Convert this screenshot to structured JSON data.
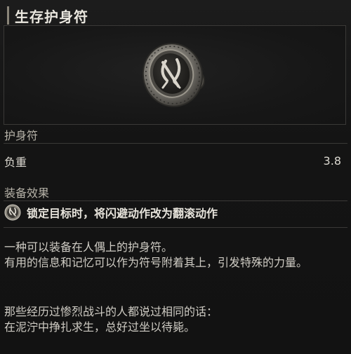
{
  "item": {
    "title": "生存护身符",
    "category": "护身符",
    "weight_label": "负重",
    "weight_value": "3.8",
    "effect_section_label": "装备效果",
    "effect_text": "锁定目标时，将闪避动作改为翻滚动作",
    "description_1": "一种可以装备在人偶上的护身符。",
    "description_2": "有用的信息和记忆可以作为符号附着其上，引发特殊的力量。",
    "description_3": "那些经历过惨烈战斗的人都说过相同的话：",
    "description_4": "在泥泞中挣扎求生，总好过坐以待毙。"
  },
  "icons": {
    "item_image": "amulet-icon",
    "effect_icon": "dodge-roll-icon"
  },
  "colors": {
    "background": "#151515",
    "text_primary": "#eae7df",
    "text_secondary": "#b6b2a8",
    "divider": "#3a3937"
  }
}
